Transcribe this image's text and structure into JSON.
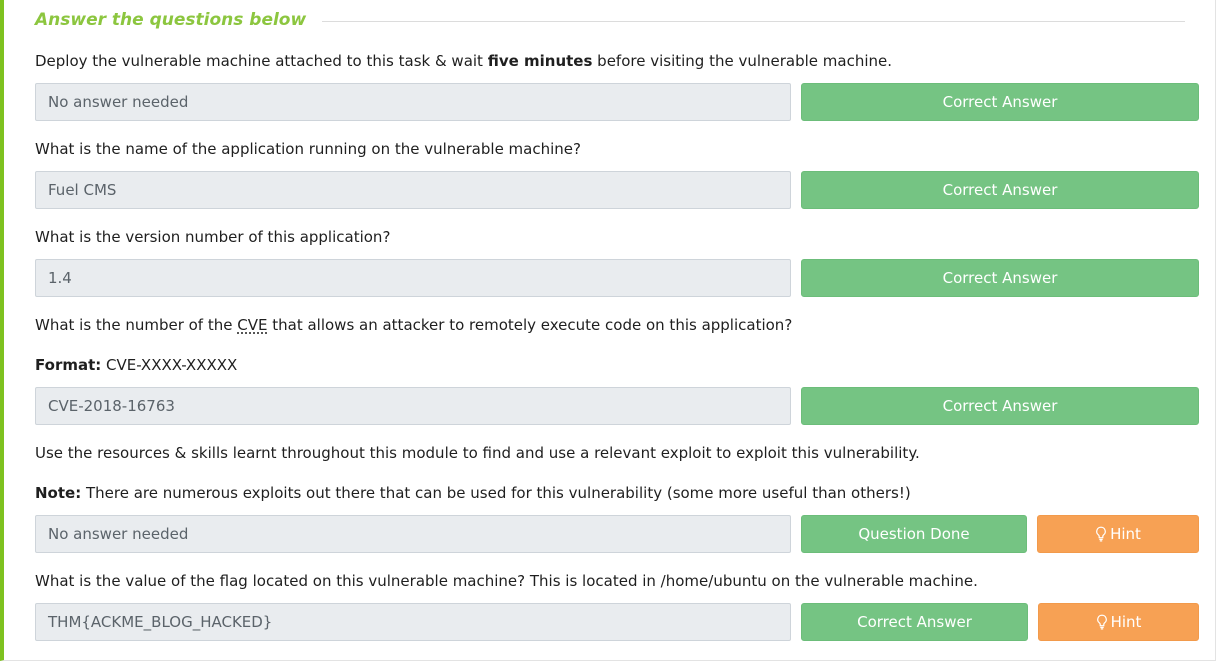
{
  "section": {
    "title": "Answer the questions below"
  },
  "questions": [
    {
      "text_before": "Deploy the vulnerable machine attached to this task & wait ",
      "text_bold": "five minutes",
      "text_after": " before visiting the vulnerable machine.",
      "answer": "No answer needed",
      "button": "Correct Answer"
    },
    {
      "text": "What is the name of the application running on the vulnerable machine?",
      "answer": "Fuel CMS",
      "button": "Correct Answer"
    },
    {
      "text": "What is the version number of this application?",
      "answer": "1.4",
      "button": "Correct Answer"
    },
    {
      "text_before": "What is the number of the ",
      "text_abbr": "CVE",
      "text_after": " that allows an attacker to remotely execute code on this application?",
      "format_label": "Format:",
      "format_value": " CVE-XXXX-XXXXX",
      "answer": "CVE-2018-16763",
      "button": "Correct Answer"
    },
    {
      "text": "Use the resources & skills learnt throughout this module to find and use a relevant exploit to exploit this vulnerability.",
      "note_label": "Note:",
      "note_value": " There are numerous exploits out there that can be used for this vulnerability (some more useful than others!)",
      "answer": "No answer needed",
      "button": "Question Done",
      "hint": "Hint"
    },
    {
      "text": "What is the value of the flag located on this vulnerable machine? This is located in /home/ubuntu on the vulnerable machine.",
      "answer": "THM{ACKME_BLOG_HACKED}",
      "button": "Correct Answer",
      "hint": "Hint"
    }
  ],
  "icons": {
    "hint": "lightbulb-icon"
  },
  "colors": {
    "accent": "#8cc63f",
    "border_accent": "#7ec21f",
    "correct": "#75c483",
    "hint": "#f7a154",
    "answer_bg": "#e9ecef"
  }
}
